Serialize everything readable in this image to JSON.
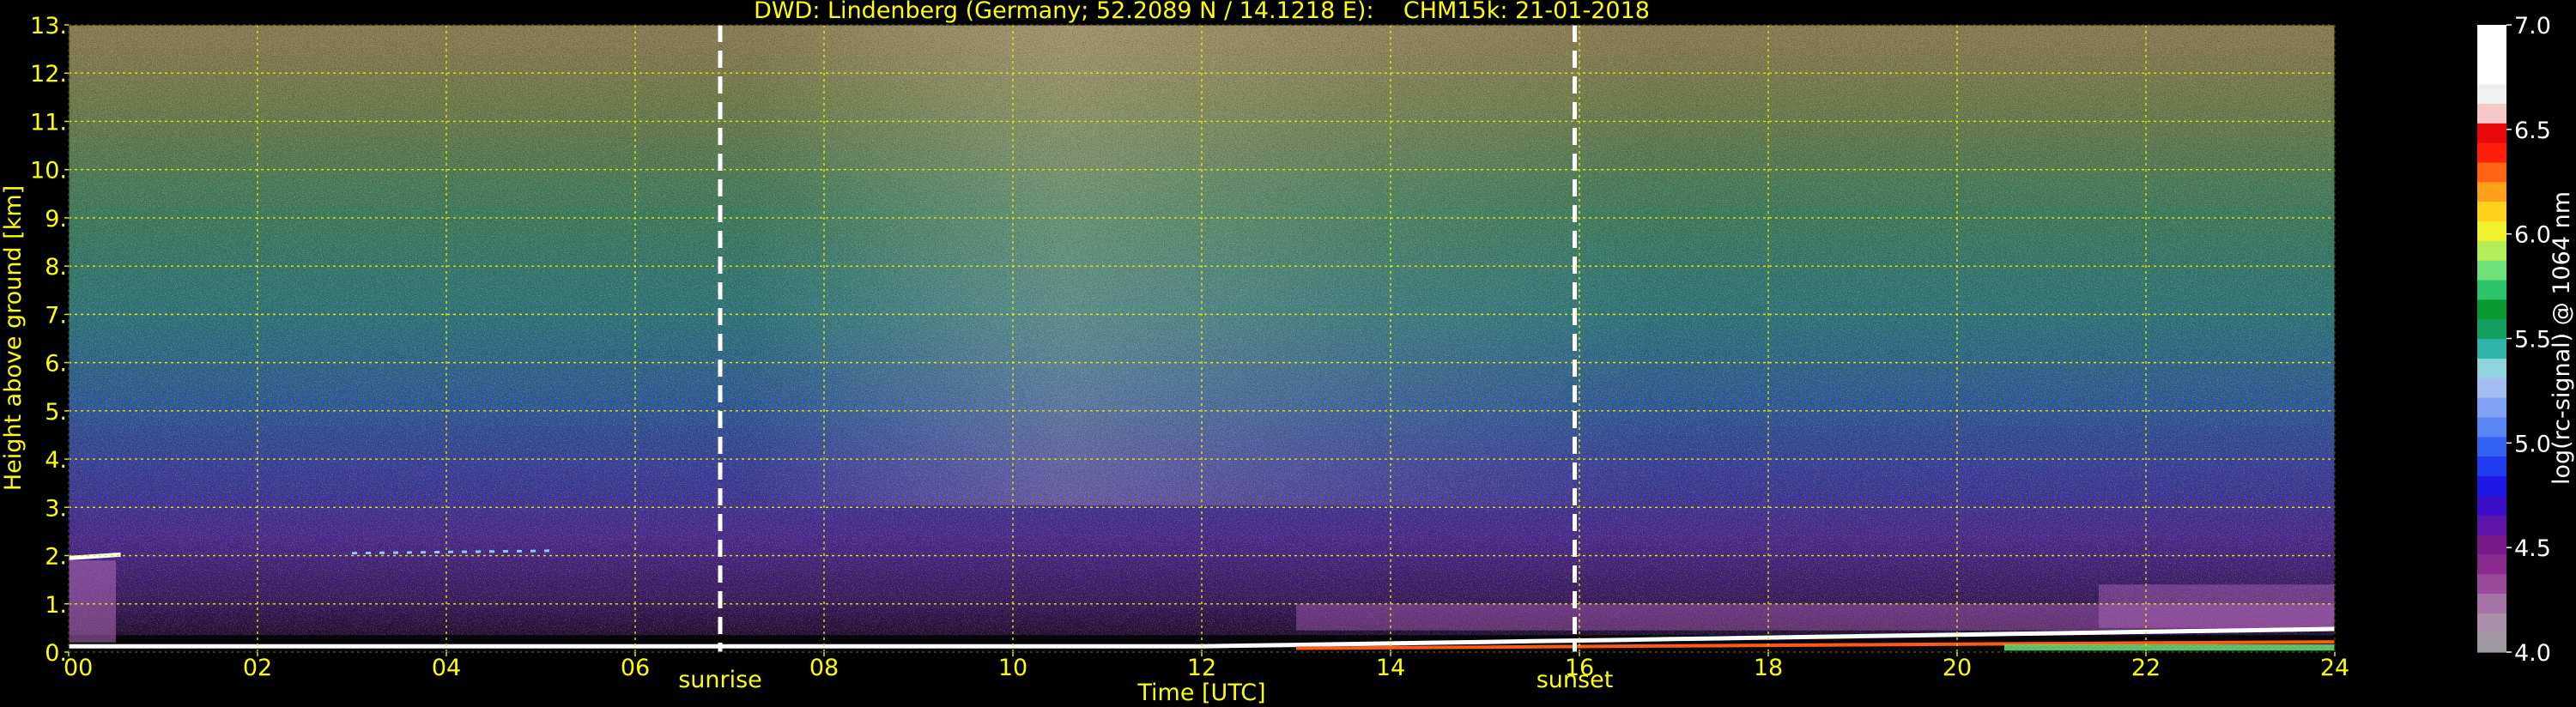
{
  "chart_data": {
    "type": "heatmap",
    "title": "DWD: Lindenberg (Germany; 52.2089 N / 14.1218 E):    CHM15k: 21-01-2018",
    "xlabel": "Time [UTC]",
    "ylabel": "Height above ground [km]",
    "xlim": [
      0,
      24
    ],
    "ylim": [
      0,
      13
    ],
    "x_ticks": [
      0,
      2,
      4,
      6,
      8,
      10,
      12,
      14,
      16,
      18,
      20,
      22,
      24
    ],
    "x_tick_labels": [
      "00",
      "02",
      "04",
      "06",
      "08",
      "10",
      "12",
      "14",
      "16",
      "18",
      "20",
      "22",
      "24"
    ],
    "y_ticks": [
      0,
      1,
      2,
      3,
      4,
      5,
      6,
      7,
      8,
      9,
      10,
      11,
      12,
      13
    ],
    "y_tick_labels": [
      "0.",
      "1.",
      "2.",
      "3.",
      "4.",
      "5.",
      "6.",
      "7.",
      "8.",
      "9.",
      "10.",
      "11.",
      "12.",
      "13."
    ],
    "grid": true,
    "markers": [
      {
        "label": "sunrise",
        "time": 6.9
      },
      {
        "label": "sunset",
        "time": 15.95
      }
    ],
    "colorbar": {
      "label": "log(rc-signal) @ 1064 nm",
      "range": [
        4.0,
        7.0
      ],
      "ticks": [
        4.0,
        4.5,
        5.0,
        5.5,
        6.0,
        6.5,
        7.0
      ],
      "tick_labels": [
        "4.0",
        "4.5",
        "5.0",
        "5.5",
        "6.0",
        "6.5",
        "7.0"
      ],
      "colors": [
        "#9f9aa2",
        "#a98fa8",
        "#a473a6",
        "#9a4a9b",
        "#8a2a8e",
        "#7a1a8a",
        "#5e14a8",
        "#3c10c8",
        "#1e18e6",
        "#1f3cf0",
        "#3362f2",
        "#5a86f4",
        "#7fa3f4",
        "#a3bdf2",
        "#8fd4dc",
        "#2fb3a8",
        "#13a060",
        "#0a9830",
        "#2ec46c",
        "#6fe07a",
        "#b6ee5a",
        "#f0f02e",
        "#ffd21e",
        "#ffa01a",
        "#ff6414",
        "#ff1e0a",
        "#e80a0a",
        "#f4c8c8",
        "#f0f0f0",
        "#ffffff",
        "#ffffff",
        "#ffffff"
      ]
    }
  }
}
